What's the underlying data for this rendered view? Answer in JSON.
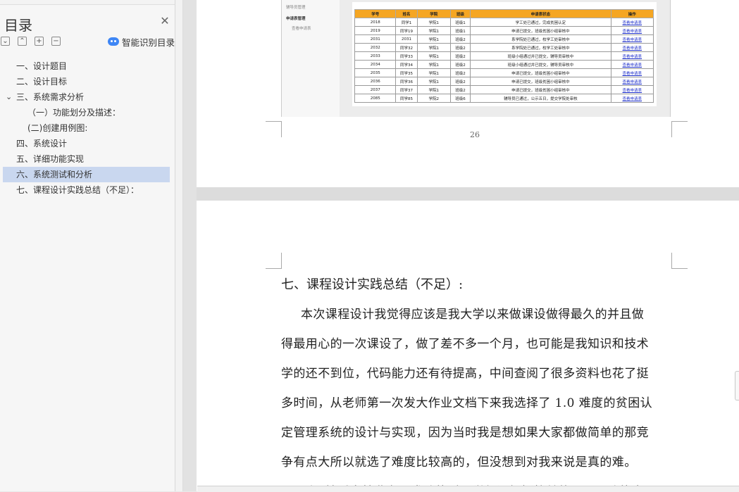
{
  "toc": {
    "title": "目录",
    "smart_label": "智能识别目录",
    "items": [
      {
        "label": "一、设计题目"
      },
      {
        "label": "二、设计目标"
      },
      {
        "label": "三、系统需求分析"
      },
      {
        "label": "（一）功能划分及描述："
      },
      {
        "label": "(二)创建用例图:"
      },
      {
        "label": "四、系统设计"
      },
      {
        "label": "五、详细功能实现"
      },
      {
        "label": "六、系统测试和分析"
      },
      {
        "label": "七、课程设计实践总结（不足）："
      }
    ],
    "active_index": 7
  },
  "page1": {
    "page_number": "26",
    "screenshot": {
      "sidebar": [
        "辅导员管理",
        "申请表管理",
        "查看申请表"
      ],
      "headers": [
        "学号",
        "姓名",
        "学院",
        "班级",
        "申请表状态",
        "操作"
      ],
      "rows": [
        [
          "2018",
          "同学1",
          "学院1",
          "班级1",
          "学工处已通过，完成贫困认定",
          "查看申请表"
        ],
        [
          "2019",
          "同学19",
          "学院1",
          "班级1",
          "申请已提交，班级贫困小组审核中",
          "查看申请表"
        ],
        [
          "2031",
          "2031",
          "学院1",
          "班级2",
          "系学院处已通过，校学工处审核中",
          "查看申请表"
        ],
        [
          "2032",
          "同学32",
          "学院1",
          "班级2",
          "系学院处已通过，校学工处审核中",
          "查看申请表"
        ],
        [
          "2033",
          "同学33",
          "学院1",
          "班级2",
          "班级小组通过并已提交，辅导员审核中",
          "查看申请表"
        ],
        [
          "2034",
          "同学34",
          "学院1",
          "班级2",
          "班级小组通过并已提交，辅导员审核中",
          "查看申请表"
        ],
        [
          "2035",
          "同学35",
          "学院1",
          "班级2",
          "申请已提交，班级贫困小组审核中",
          "查看申请表"
        ],
        [
          "2036",
          "同学36",
          "学院1",
          "班级2",
          "申请已提交，班级贫困小组审核中",
          "查看申请表"
        ],
        [
          "2037",
          "同学37",
          "学院1",
          "班级2",
          "申请已提交，班级贫困小组审核中",
          "查看申请表"
        ],
        [
          "2085",
          "同学85",
          "学院2",
          "班级6",
          "辅导员已通过，公示五日，提交学院处审核",
          "查看申请表"
        ]
      ]
    }
  },
  "page2": {
    "heading": "七、课程设计实践总结（不足）:",
    "lines": [
      "本次课程设计我觉得应该是我大学以来做课设做得最久的并且做",
      "得最用心的一次课设了，做了差不多一个月，也可能是我知识和技术",
      "学的还不到位，代码能力还有待提高，中间查阅了很多资料也花了挺",
      "多时间，从老师第一次发大作业文档下来我选择了 1.0 难度的贫困认",
      "定管理系统的设计与实现，因为当时我是想如果大家都做简单的那竞",
      "争有点大所以就选了难度比较高的，但没想到对我来说是真的难。",
      "刚开始看文档业务需求功能时，觉得逻辑挺简单的，而且功能点"
    ]
  }
}
